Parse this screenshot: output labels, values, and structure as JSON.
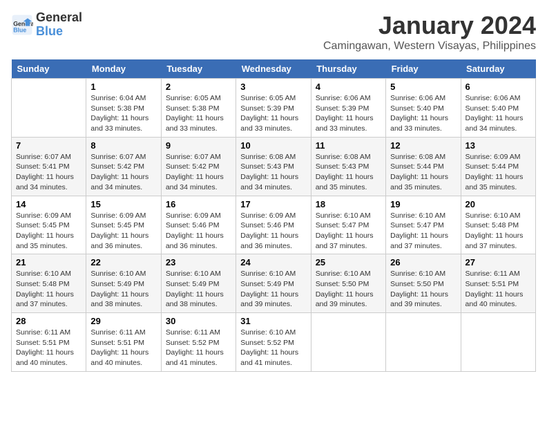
{
  "logo": {
    "line1": "General",
    "line2": "Blue"
  },
  "title": "January 2024",
  "subtitle": "Camingawan, Western Visayas, Philippines",
  "weekdays": [
    "Sunday",
    "Monday",
    "Tuesday",
    "Wednesday",
    "Thursday",
    "Friday",
    "Saturday"
  ],
  "weeks": [
    [
      {
        "day": "",
        "info": ""
      },
      {
        "day": "1",
        "info": "Sunrise: 6:04 AM\nSunset: 5:38 PM\nDaylight: 11 hours\nand 33 minutes."
      },
      {
        "day": "2",
        "info": "Sunrise: 6:05 AM\nSunset: 5:38 PM\nDaylight: 11 hours\nand 33 minutes."
      },
      {
        "day": "3",
        "info": "Sunrise: 6:05 AM\nSunset: 5:39 PM\nDaylight: 11 hours\nand 33 minutes."
      },
      {
        "day": "4",
        "info": "Sunrise: 6:06 AM\nSunset: 5:39 PM\nDaylight: 11 hours\nand 33 minutes."
      },
      {
        "day": "5",
        "info": "Sunrise: 6:06 AM\nSunset: 5:40 PM\nDaylight: 11 hours\nand 33 minutes."
      },
      {
        "day": "6",
        "info": "Sunrise: 6:06 AM\nSunset: 5:40 PM\nDaylight: 11 hours\nand 34 minutes."
      }
    ],
    [
      {
        "day": "7",
        "info": "Sunrise: 6:07 AM\nSunset: 5:41 PM\nDaylight: 11 hours\nand 34 minutes."
      },
      {
        "day": "8",
        "info": "Sunrise: 6:07 AM\nSunset: 5:42 PM\nDaylight: 11 hours\nand 34 minutes."
      },
      {
        "day": "9",
        "info": "Sunrise: 6:07 AM\nSunset: 5:42 PM\nDaylight: 11 hours\nand 34 minutes."
      },
      {
        "day": "10",
        "info": "Sunrise: 6:08 AM\nSunset: 5:43 PM\nDaylight: 11 hours\nand 34 minutes."
      },
      {
        "day": "11",
        "info": "Sunrise: 6:08 AM\nSunset: 5:43 PM\nDaylight: 11 hours\nand 35 minutes."
      },
      {
        "day": "12",
        "info": "Sunrise: 6:08 AM\nSunset: 5:44 PM\nDaylight: 11 hours\nand 35 minutes."
      },
      {
        "day": "13",
        "info": "Sunrise: 6:09 AM\nSunset: 5:44 PM\nDaylight: 11 hours\nand 35 minutes."
      }
    ],
    [
      {
        "day": "14",
        "info": "Sunrise: 6:09 AM\nSunset: 5:45 PM\nDaylight: 11 hours\nand 35 minutes."
      },
      {
        "day": "15",
        "info": "Sunrise: 6:09 AM\nSunset: 5:45 PM\nDaylight: 11 hours\nand 36 minutes."
      },
      {
        "day": "16",
        "info": "Sunrise: 6:09 AM\nSunset: 5:46 PM\nDaylight: 11 hours\nand 36 minutes."
      },
      {
        "day": "17",
        "info": "Sunrise: 6:09 AM\nSunset: 5:46 PM\nDaylight: 11 hours\nand 36 minutes."
      },
      {
        "day": "18",
        "info": "Sunrise: 6:10 AM\nSunset: 5:47 PM\nDaylight: 11 hours\nand 37 minutes."
      },
      {
        "day": "19",
        "info": "Sunrise: 6:10 AM\nSunset: 5:47 PM\nDaylight: 11 hours\nand 37 minutes."
      },
      {
        "day": "20",
        "info": "Sunrise: 6:10 AM\nSunset: 5:48 PM\nDaylight: 11 hours\nand 37 minutes."
      }
    ],
    [
      {
        "day": "21",
        "info": "Sunrise: 6:10 AM\nSunset: 5:48 PM\nDaylight: 11 hours\nand 37 minutes."
      },
      {
        "day": "22",
        "info": "Sunrise: 6:10 AM\nSunset: 5:49 PM\nDaylight: 11 hours\nand 38 minutes."
      },
      {
        "day": "23",
        "info": "Sunrise: 6:10 AM\nSunset: 5:49 PM\nDaylight: 11 hours\nand 38 minutes."
      },
      {
        "day": "24",
        "info": "Sunrise: 6:10 AM\nSunset: 5:49 PM\nDaylight: 11 hours\nand 39 minutes."
      },
      {
        "day": "25",
        "info": "Sunrise: 6:10 AM\nSunset: 5:50 PM\nDaylight: 11 hours\nand 39 minutes."
      },
      {
        "day": "26",
        "info": "Sunrise: 6:10 AM\nSunset: 5:50 PM\nDaylight: 11 hours\nand 39 minutes."
      },
      {
        "day": "27",
        "info": "Sunrise: 6:11 AM\nSunset: 5:51 PM\nDaylight: 11 hours\nand 40 minutes."
      }
    ],
    [
      {
        "day": "28",
        "info": "Sunrise: 6:11 AM\nSunset: 5:51 PM\nDaylight: 11 hours\nand 40 minutes."
      },
      {
        "day": "29",
        "info": "Sunrise: 6:11 AM\nSunset: 5:51 PM\nDaylight: 11 hours\nand 40 minutes."
      },
      {
        "day": "30",
        "info": "Sunrise: 6:11 AM\nSunset: 5:52 PM\nDaylight: 11 hours\nand 41 minutes."
      },
      {
        "day": "31",
        "info": "Sunrise: 6:10 AM\nSunset: 5:52 PM\nDaylight: 11 hours\nand 41 minutes."
      },
      {
        "day": "",
        "info": ""
      },
      {
        "day": "",
        "info": ""
      },
      {
        "day": "",
        "info": ""
      }
    ]
  ]
}
